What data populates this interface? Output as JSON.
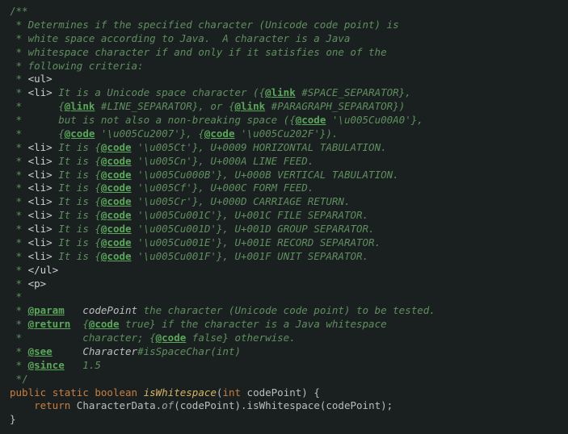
{
  "doc": {
    "open": "/**",
    "d1": " * Determines if the specified character (Unicode code point) is",
    "d2": " * white space according to Java.  A character is a Java",
    "d3": " * whitespace character if and only if it satisfies one of the",
    "d4": " * following criteria:",
    "ul_open": "<ul>",
    "li": "<li>",
    "ul_close": "</ul>",
    "p_tag": "<p>",
    "crit1a": " It is a Unicode space character (",
    "crit1a_link": "@link",
    "crit1a_ref": " #SPACE_SEPARATOR",
    "crit1b_pre": "}, ",
    "crit1b_mid": "      {",
    "crit1b_ref": " #LINE_SEPARATOR",
    "crit1b_or": "}, or {",
    "crit1b_ref2": " #PARAGRAPH_SEPARATOR",
    "crit1b_end": "})",
    "crit1c": "      but is not also a non-breaking space (",
    "code_tag": "@code",
    "nb1": " '\\u005Cu00A0'",
    "nb1_sep": "},",
    "crit1d_pre": "      {",
    "nb2": " '\\u005Cu2007'",
    "nb2_sep": "}, {",
    "nb3": " '\\u005Cu202F'",
    "nb3_end": "}).",
    "it_is": " It is {",
    "ct": " '\\u005Ct'",
    "ct_desc": "}, U+0009 HORIZONTAL TABULATION.",
    "cn": " '\\u005Cn'",
    "cn_desc": "}, U+000A LINE FEED.",
    "c0b": " '\\u005Cu000B'",
    "c0b_desc": "}, U+000B VERTICAL TABULATION.",
    "cf": " '\\u005Cf'",
    "cf_desc": "}, U+000C FORM FEED.",
    "cr": " '\\u005Cr'",
    "cr_desc": "}, U+000D CARRIAGE RETURN.",
    "c1c": " '\\u005Cu001C'",
    "c1c_desc": "}, U+001C FILE SEPARATOR.",
    "c1d": " '\\u005Cu001D'",
    "c1d_desc": "}, U+001D GROUP SEPARATOR.",
    "c1e": " '\\u005Cu001E'",
    "c1e_desc": "}, U+001E RECORD SEPARATOR.",
    "c1f": " '\\u005Cu001F'",
    "c1f_desc": "}, U+001F UNIT SEPARATOR.",
    "param_tag": "@param",
    "param_name": "   codePoint",
    "param_desc": " the character (Unicode code point) to be tested.",
    "return_tag": "@return",
    "return_pre": "  {",
    "return_true": " true",
    "return_mid": "} if the character is a Java whitespace",
    "return_l2_pre": " *          character; {",
    "return_false": " false",
    "return_l2_end": "} otherwise.",
    "see_tag": "@see",
    "see_pre": "     ",
    "see_class": "Character",
    "see_rest": "#isSpaceChar(int)",
    "since_tag": "@since",
    "since_val": "   1.5",
    "close": " */"
  },
  "code": {
    "kw_public": "public",
    "kw_static": "static",
    "kw_boolean": "boolean",
    "fn_name": "isWhitespace",
    "lp": "(",
    "kw_int": "int",
    "arg": " codePoint",
    "rp_brace": ") {",
    "kw_return": "return",
    "cls": " CharacterData",
    "dot1": ".",
    "of": "of",
    "args1": "(codePoint)",
    "dot2": ".",
    "m2": "isWhitespace",
    "args2": "(codePoint)",
    "semi": ";",
    "rbrace": "}"
  }
}
